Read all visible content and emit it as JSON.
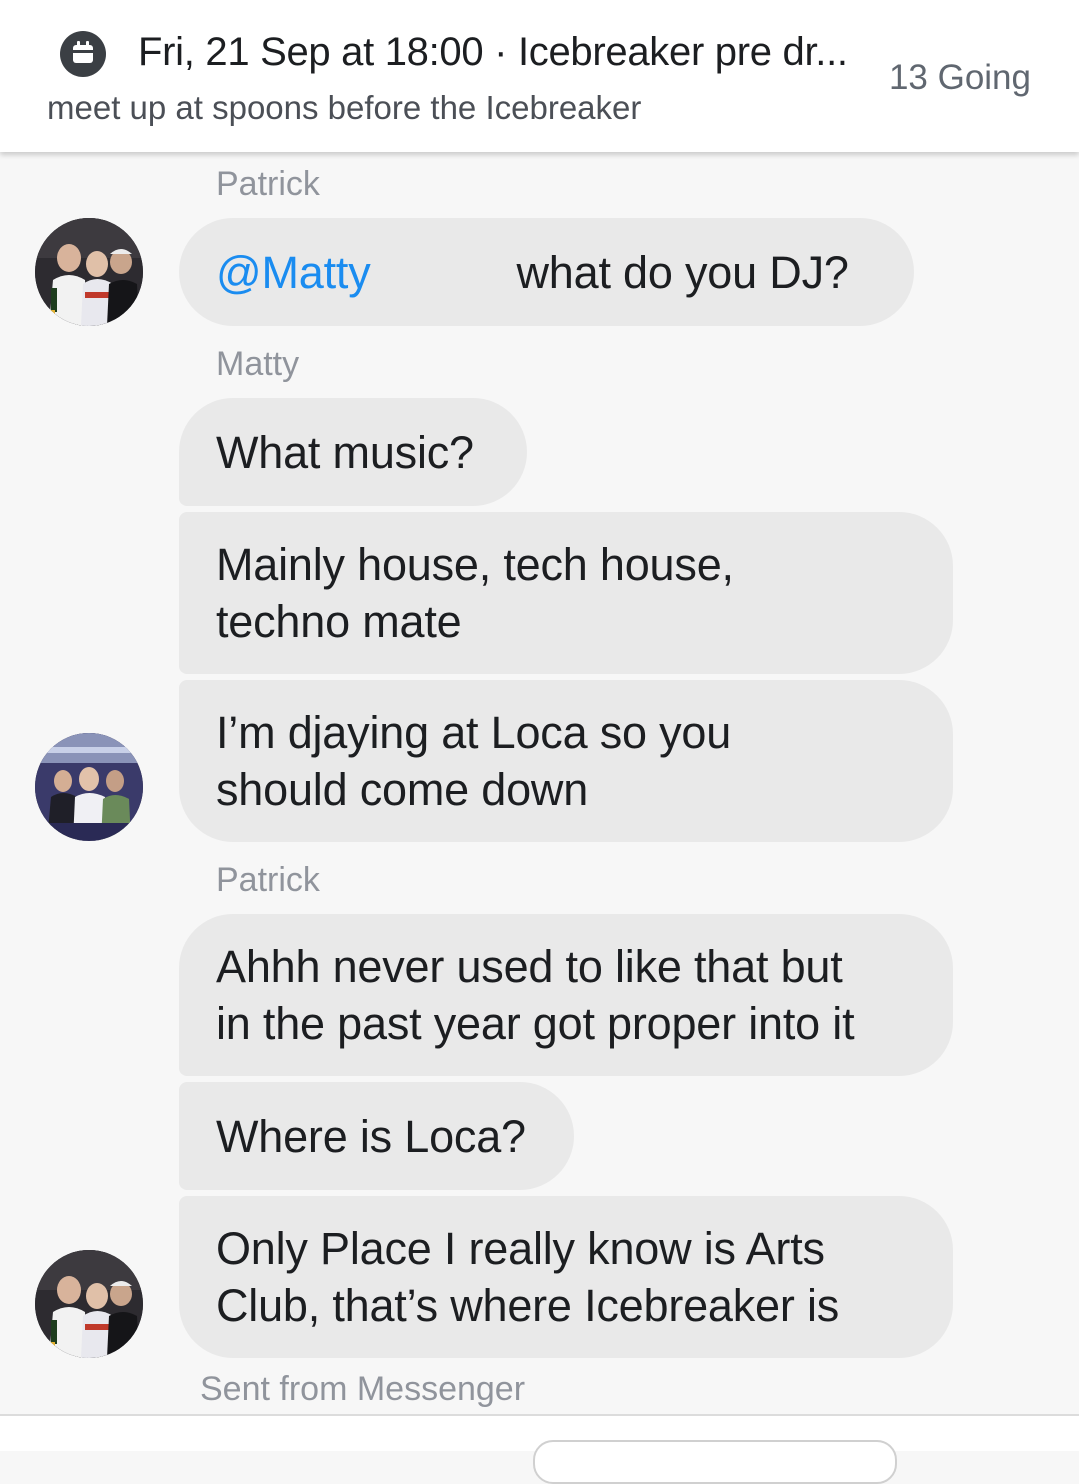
{
  "event": {
    "title": "Fri, 21 Sep at 18:00 · Icebreaker pre dr...",
    "subtitle": "meet up at spoons before the Icebreaker",
    "going": "13 Going",
    "icon": "calendar-icon"
  },
  "messages": [
    {
      "sender": "Patrick"
    },
    {
      "mention": "@Matty",
      "text": "what do you DJ?"
    },
    {
      "sender": "Matty"
    },
    {
      "text": "What music?"
    },
    {
      "text": "Mainly house, tech house,\ntechno mate"
    },
    {
      "text": "I’m djaying at Loca so you\nshould come down"
    },
    {
      "sender": "Patrick"
    },
    {
      "text": "Ahhh never used to like that but\nin the past year got proper into it"
    },
    {
      "text": "Where is Loca?"
    },
    {
      "text": "Only Place I really know is Arts\nClub, that’s where Icebreaker is"
    }
  ],
  "footer": {
    "sent_from": "Sent from Messenger"
  },
  "colors": {
    "mention": "#1a8cf0",
    "bubble": "#e9e9e9",
    "background": "#f7f7f7",
    "sender_name": "#90949c"
  }
}
